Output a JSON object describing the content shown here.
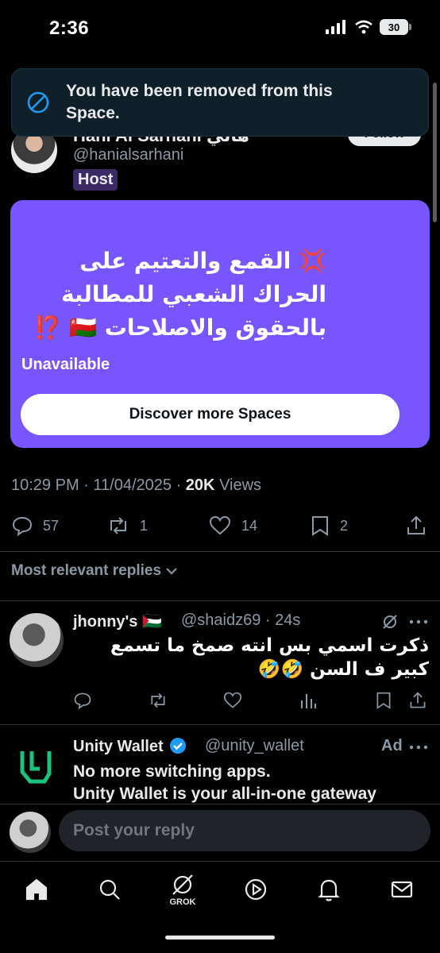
{
  "status_bar": {
    "time": "2:36",
    "battery": "30"
  },
  "toast": {
    "message": "You have been removed from this Space."
  },
  "host": {
    "name": "Hani Al Sarhani هاني",
    "handle": "@hanialsarhani",
    "badge": "Host",
    "follow_label": "Follow"
  },
  "space": {
    "title": "💢 القمع والتعتيم على الحراك الشعبي للمطالبة بالحقوق والاصلاحات 🇴🇲 ⁉️",
    "status": "Unavailable",
    "button": "Discover more Spaces",
    "color": "#7856ff"
  },
  "post_meta": {
    "time": "10:29 PM",
    "date": "11/04/2025",
    "views_count": "20K",
    "views_label": "Views"
  },
  "actions": {
    "replies": "57",
    "reposts": "1",
    "likes": "14",
    "bookmarks": "2"
  },
  "replies_filter": {
    "label": "Most relevant replies"
  },
  "reply": {
    "name": "jhonny's 🇵🇸",
    "handle": "@shaidz69",
    "time": "24s",
    "text": "ذكرت اسمي بس انته صمخ ما تسمع كبير ف السن 🤣🤣"
  },
  "ad": {
    "name": "Unity Wallet",
    "handle": "@unity_wallet",
    "label": "Ad",
    "line1": "No more switching apps.",
    "line2": "Unity Wallet is your all-in-one gateway"
  },
  "reply_bar": {
    "placeholder": "Post your reply"
  },
  "tabs": {
    "grok_label": "GROK"
  }
}
